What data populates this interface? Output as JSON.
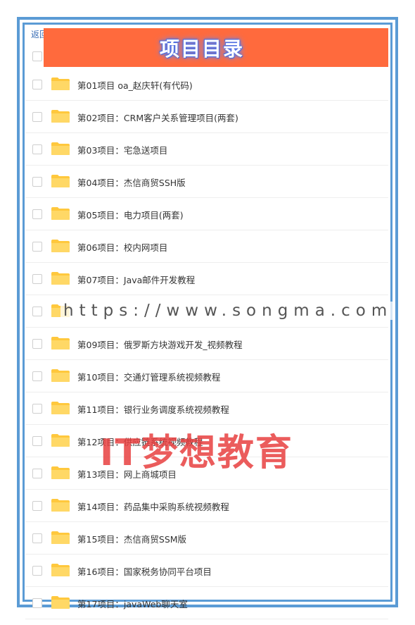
{
  "back_link": "返回",
  "banner": {
    "title": "项目目录",
    "color": "#ff6a3d"
  },
  "folder_color": "#ffc83d",
  "items": [
    {
      "label": "第01项目 oa_赵庆轩(有代码)"
    },
    {
      "label": "第02项目：CRM客户关系管理项目(两套)"
    },
    {
      "label": "第03项目：宅急送项目"
    },
    {
      "label": "第04项目：杰信商贸SSH版"
    },
    {
      "label": "第05项目：电力项目(两套)"
    },
    {
      "label": "第06项目：校内网项目"
    },
    {
      "label": "第07项目：Java邮件开发教程"
    },
    {
      "label": ""
    },
    {
      "label": "第09项目：俄罗斯方块游戏开发_视频教程"
    },
    {
      "label": "第10项目：交通灯管理系统视频教程"
    },
    {
      "label": "第11项目：银行业务调度系统视频教程"
    },
    {
      "label": "第12项目：供应链系统视频教程"
    },
    {
      "label": "第13项目：网上商城项目"
    },
    {
      "label": "第14项目：药品集中采购系统视频教程"
    },
    {
      "label": "第15项目：杰信商贸SSM版"
    },
    {
      "label": "第16项目：国家税务协同平台项目"
    },
    {
      "label": "第17项目：javaWeb聊天室"
    }
  ],
  "watermark": {
    "url": "https://www.songma.com",
    "brand": "IT梦想教育"
  }
}
